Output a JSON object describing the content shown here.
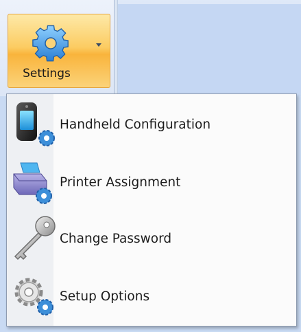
{
  "ribbon": {
    "settings_button": {
      "label": "Settings",
      "icon": "gear-icon"
    }
  },
  "menu": {
    "items": [
      {
        "label": "Handheld Configuration",
        "icon": "handheld-gear-icon"
      },
      {
        "label": "Printer Assignment",
        "icon": "printer-gear-icon"
      },
      {
        "label": "Change Password",
        "icon": "key-icon"
      },
      {
        "label": "Setup Options",
        "icon": "gears-icon"
      }
    ]
  },
  "colors": {
    "button_highlight": "#fccc62",
    "button_border": "#e3a33f",
    "gear_blue": "#3d8fd9",
    "ribbon_blue": "#c5d7f3"
  }
}
